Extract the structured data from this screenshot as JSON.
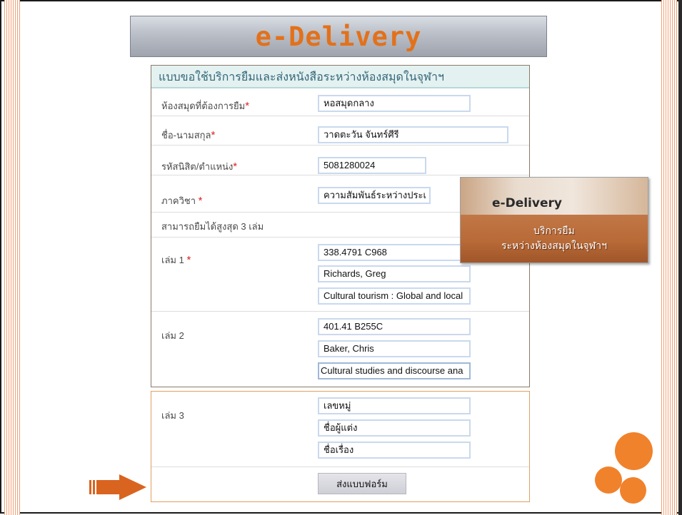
{
  "header": {
    "title": "e-Delivery"
  },
  "form": {
    "heading": "แบบขอใช้บริการยืมและส่งหนังสือระหว่างห้องสมุดในจุฬาฯ",
    "library_label": "ห้องสมุดที่ต้องการยืม",
    "library_value": "หอสมุดกลาง",
    "name_label": "ชื่อ-นามสกุล",
    "name_value": "วาดตะวัน จันทร์ศีรี",
    "id_label": "รหัสนิสิต/ตำแหน่ง",
    "id_value": "5081280024",
    "dept_label": "ภาควิชา",
    "dept_value": "ความสัมพันธ์ระหว่างประเ",
    "limit_note": "สามารถยืมได้สูงสุด 3 เล่ม",
    "required_mark": "*",
    "books": [
      {
        "label": "เล่ม 1",
        "call_no": "338.4791 C968",
        "author": "Richards, Greg",
        "title": "Cultural tourism : Global and local"
      },
      {
        "label": "เล่ม 2",
        "call_no": "401.41 B255C",
        "author": "Baker, Chris",
        "title": "Cultural studies and discourse ana"
      },
      {
        "label": "เล่ม 3",
        "call_no": "เลขหมู่",
        "author": "ชื่อผู้แต่ง",
        "title": "ชื่อเรื่อง"
      }
    ],
    "submit_label": "ส่งแบบฟอร์ม"
  },
  "promo": {
    "title": "e-Delivery",
    "line1": "บริการยืม",
    "line2": "ระหว่างห้องสมุดในจุฬาฯ"
  },
  "colors": {
    "accent": "#e3711a",
    "circles": "#f0822b",
    "arrow": "#d9641f"
  }
}
